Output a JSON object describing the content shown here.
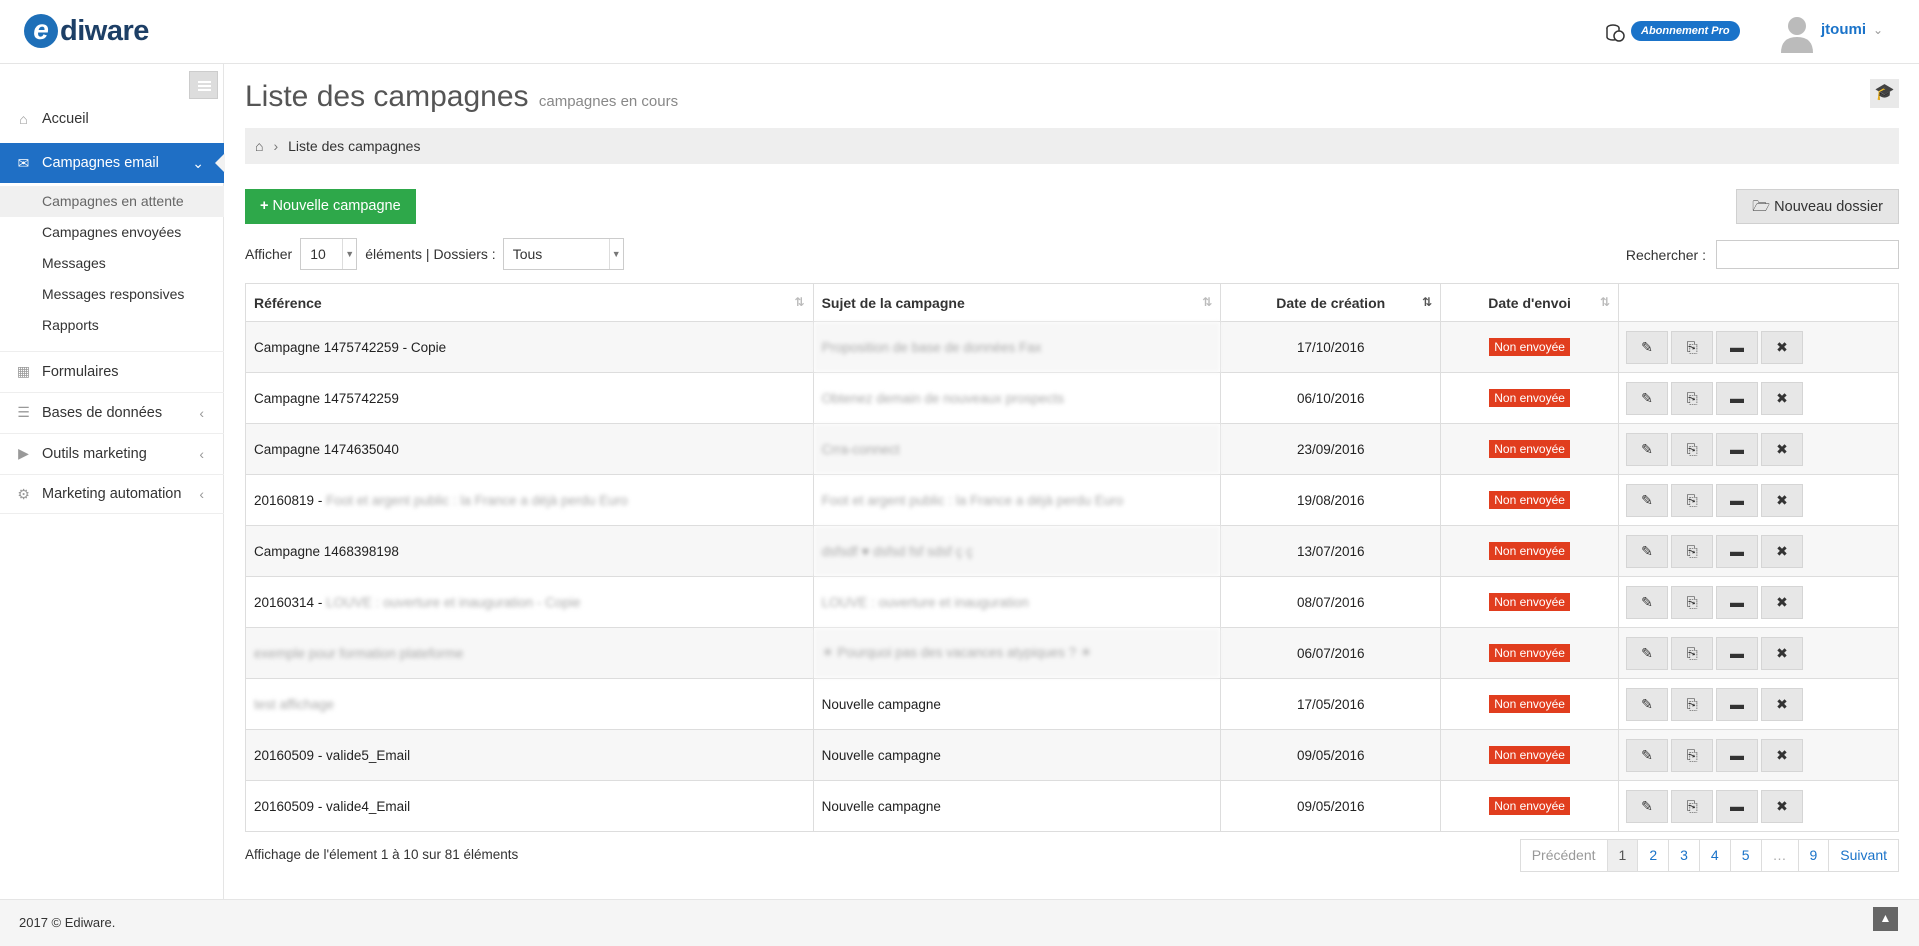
{
  "brand": {
    "logo_e": "e",
    "logo_text": "diware"
  },
  "header": {
    "subscription_badge": "Abonnement Pro",
    "user_name": "jtoumi"
  },
  "sidebar": {
    "items": [
      {
        "label": "Accueil",
        "icon": "home-icon"
      },
      {
        "label": "Campagnes email",
        "icon": "envelope-icon"
      },
      {
        "label": "Formulaires",
        "icon": "table-icon"
      },
      {
        "label": "Bases de données",
        "icon": "list-icon"
      },
      {
        "label": "Outils marketing",
        "icon": "video-icon"
      },
      {
        "label": "Marketing automation",
        "icon": "gears-icon"
      }
    ],
    "subitems": [
      "Campagnes en attente",
      "Campagnes envoyées",
      "Messages",
      "Messages responsives",
      "Rapports"
    ]
  },
  "page": {
    "title": "Liste des campagnes",
    "subtitle": "campagnes en cours",
    "breadcrumb": "Liste des campagnes",
    "new_campaign_label": "Nouvelle campagne",
    "new_folder_label": "Nouveau dossier",
    "show_label": "Afficher",
    "page_size": "10",
    "elements_label": "éléments | Dossiers :",
    "folder_value": "Tous",
    "search_label": "Rechercher :"
  },
  "table": {
    "headers": [
      "Référence",
      "Sujet de la campagne",
      "Date de création",
      "Date d'envoi"
    ],
    "rows": [
      {
        "ref": "Campagne 1475742259 - Copie",
        "ref_blur": "",
        "subject": "Proposition de base de données Fax",
        "subject_blur": true,
        "created": "17/10/2016",
        "status": "Non envoyée"
      },
      {
        "ref": "Campagne 1475742259",
        "ref_blur": "",
        "subject": "Obtenez demain de nouveaux prospects",
        "subject_blur": true,
        "created": "06/10/2016",
        "status": "Non envoyée"
      },
      {
        "ref": "Campagne 1474635040",
        "ref_blur": "",
        "subject": "Crra-connect",
        "subject_blur": true,
        "created": "23/09/2016",
        "status": "Non envoyée"
      },
      {
        "ref": "20160819 - ",
        "ref_blur": "Foot et argent public : la France a déjà perdu Euro",
        "subject": "Foot et argent public : la France a déjà perdu Euro",
        "subject_blur": true,
        "created": "19/08/2016",
        "status": "Non envoyée"
      },
      {
        "ref": "Campagne 1468398198",
        "ref_blur": "",
        "subject": "dsfsdf ♥ dsfsd fsf sdsf ç ç",
        "subject_blur": true,
        "created": "13/07/2016",
        "status": "Non envoyée"
      },
      {
        "ref": "20160314 - ",
        "ref_blur": "LOUVE : ouverture et inauguration - Copie",
        "subject": "LOUVE : ouverture et inauguration",
        "subject_blur": true,
        "created": "08/07/2016",
        "status": "Non envoyée"
      },
      {
        "ref": "",
        "ref_blur": "exemple pour formation plateforme",
        "subject": "☀ Pourquoi pas des vacances atypiques ? ☀",
        "subject_blur": true,
        "created": "06/07/2016",
        "status": "Non envoyée"
      },
      {
        "ref": "",
        "ref_blur": "test affichage",
        "subject": "Nouvelle campagne",
        "subject_blur": false,
        "created": "17/05/2016",
        "status": "Non envoyée"
      },
      {
        "ref": "20160509 - valide5_Email",
        "ref_blur": "",
        "subject": "Nouvelle campagne",
        "subject_blur": false,
        "created": "09/05/2016",
        "status": "Non envoyée"
      },
      {
        "ref": "20160509 - valide4_Email",
        "ref_blur": "",
        "subject": "Nouvelle campagne",
        "subject_blur": false,
        "created": "09/05/2016",
        "status": "Non envoyée"
      }
    ],
    "row_actions": [
      "edit-icon",
      "copy-icon",
      "folder-open-icon",
      "trash-icon"
    ]
  },
  "pagination": {
    "info": "Affichage de l'élement 1 à 10 sur 81 éléments",
    "prev": "Précédent",
    "pages": [
      "1",
      "2",
      "3",
      "4",
      "5",
      "…",
      "9"
    ],
    "current": "1",
    "next": "Suivant"
  },
  "footer": {
    "copyright": "2017 © Ediware."
  },
  "colors": {
    "primary": "#1f6fc5",
    "success": "#2ea84a",
    "danger": "#e13d1e",
    "brand_dark": "#1d3f66"
  }
}
